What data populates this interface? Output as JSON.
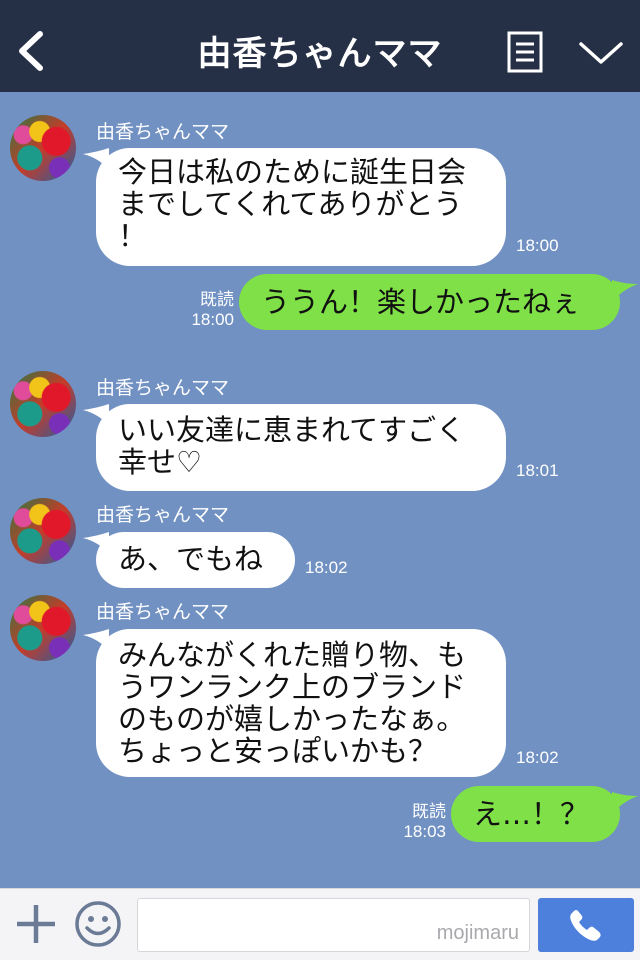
{
  "header": {
    "title": "由香ちゃんママ",
    "back_icon": "chevron-left-icon",
    "menu_icon": "list-icon",
    "collapse_icon": "chevron-down-icon"
  },
  "messages": [
    {
      "sender": "由香ちゃんママ",
      "direction": "in",
      "lines": [
        "今日は私のために誕生日会",
        "までしてくれてありがとう",
        "！"
      ],
      "time": "18:00"
    },
    {
      "direction": "out",
      "lines": [
        "ううん！楽しかったねぇ"
      ],
      "read": "既読",
      "time": "18:00"
    },
    {
      "sender": "由香ちゃんママ",
      "direction": "in",
      "lines": [
        "いい友達に恵まれてすごく",
        "幸せ♡"
      ],
      "time": "18:01"
    },
    {
      "sender": "由香ちゃんママ",
      "direction": "in",
      "lines": [
        "あ、でもね"
      ],
      "time": "18:02"
    },
    {
      "sender": "由香ちゃんママ",
      "direction": "in",
      "lines": [
        "みんながくれた贈り物、も",
        "うワンランク上のブランド",
        "のものが嬉しかったなぁ。",
        "ちょっと安っぽいかも？"
      ],
      "time": "18:02"
    },
    {
      "direction": "out",
      "lines": [
        "え…！？"
      ],
      "read": "既読",
      "time": "18:03"
    }
  ],
  "footer": {
    "plus_icon": "plus-icon",
    "emoji_icon": "smiley-icon",
    "input_value": "",
    "watermark": "mojimaru",
    "call_icon": "phone-icon"
  },
  "colors": {
    "header_bg": "#252f45",
    "chat_bg": "#7191c2",
    "incoming_bubble": "#ffffff",
    "outgoing_bubble": "#7fe047",
    "call_button": "#4d80dc"
  }
}
